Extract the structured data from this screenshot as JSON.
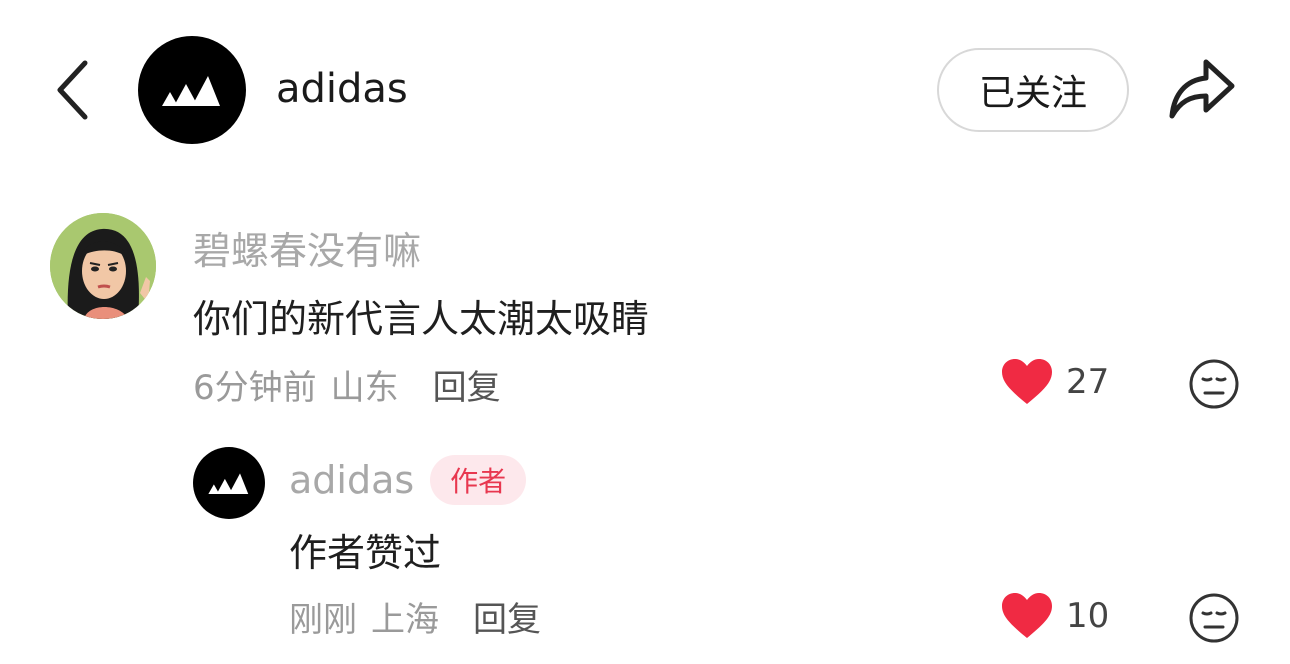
{
  "header": {
    "back_icon": "chevron-left-icon",
    "account_name": "adidas",
    "follow_label": "已关注",
    "share_icon": "share-arrow-icon"
  },
  "comments": [
    {
      "username": "碧螺春没有嘛",
      "avatar": "cartoon-woman-avatar",
      "text": "你们的新代言人太潮太吸睛",
      "time": "6分钟前",
      "location": "山东",
      "reply_label": "回复",
      "likes": "27"
    }
  ],
  "reply": {
    "username": "adidas",
    "badge": "作者",
    "text": "作者赞过",
    "time": "刚刚",
    "location": "上海",
    "reply_label": "回复",
    "likes": "10"
  },
  "colors": {
    "heart": "#f02a43",
    "badge_text": "#e8374f",
    "badge_bg": "#fde8ec"
  }
}
